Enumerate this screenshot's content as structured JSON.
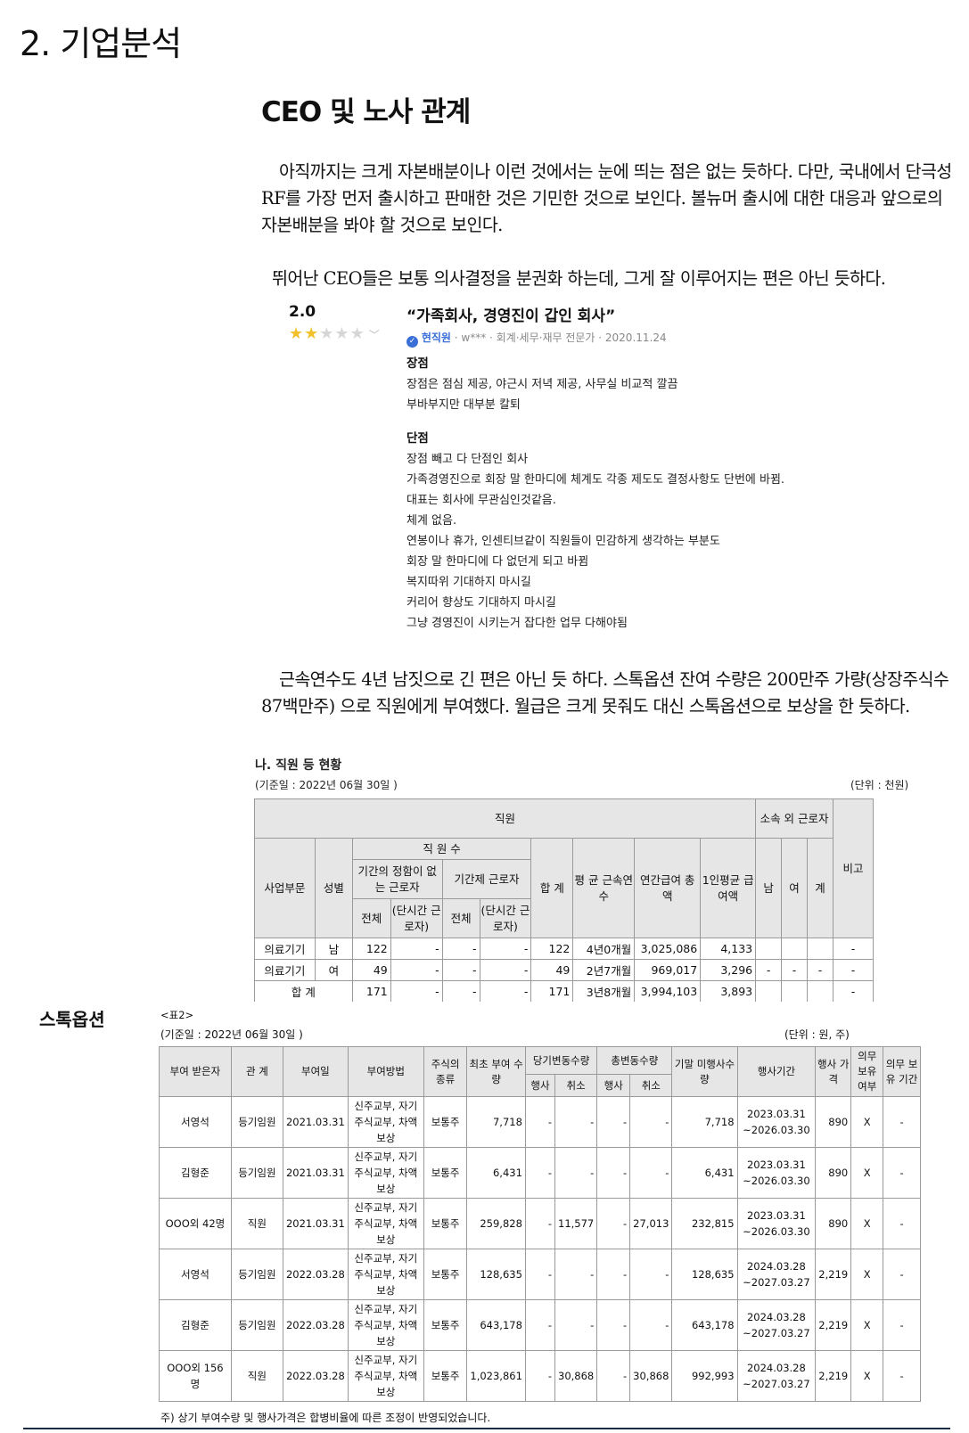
{
  "heading": "2. 기업분석",
  "subheading": "CEO 및 노사 관계",
  "paragraphs": {
    "p1": "아직까지는 크게 자본배분이나 이런 것에서는 눈에 띄는 점은 없는 듯하다. 다만, 국내에서 단극성 RF를 가장 먼저 출시하고 판매한 것은 기민한 것으로 보인다. 볼뉴머 출시에 대한 대응과 앞으로의 자본배분을 봐야 할 것으로 보인다.",
    "p2": "뛰어난 CEO들은 보통 의사결정을 분권화 하는데, 그게 잘 이루어지는 편은 아닌 듯하다.",
    "p3": "근속연수도 4년 남짓으로 긴 편은 아닌 듯 하다. 스톡옵션 잔여 수량은 200만주 가량(상장주식수 87백만주) 으로 직원에게 부여했다. 월급은 크게 못줘도 대신 스톡옵션으로 보상을 한 듯하다."
  },
  "review": {
    "score": "2.0",
    "stars_filled": 2,
    "stars_total": 5,
    "title": "“가족회사, 경영진이 갑인 회사”",
    "author": "현직원",
    "meta": " · w*** · 회계·세무·재무 전문가 · 2020.11.24",
    "pros_label": "장점",
    "pros": [
      "장점은 점심 제공, 야근시 저녁 제공, 사무실 비교적 깔끔",
      "부바부지만 대부분 칼퇴"
    ],
    "cons_label": "단점",
    "cons": [
      "장점 빼고 다 단점인 회사",
      "가족경영진으로 회장 말 한마디에 체계도 각종 제도도 결정사항도 단번에 바뀜.",
      "대표는 회사에 무관심인것같음.",
      "체계 없음.",
      "연봉이나 휴가, 인센티브같이 직원들이 민감하게 생각하는 부분도",
      "회장 말 한마디에 다 없던게 되고 바뀜",
      "복지따위 기대하지 마시길",
      "커리어 향상도 기대하지 마시길",
      "그냥 경영진이 시키는거 잡다한 업무 다해야됨"
    ]
  },
  "staff_table": {
    "title": "나. 직원 등 현황",
    "base_date": "(기준일 :      2022년 06월 30일    )",
    "unit": "(단위 : 천원)",
    "h_staff": "직원",
    "h_outside": "소속 외 근로자",
    "h_note": "비고",
    "h_dept": "사업부문",
    "h_gender": "성별",
    "h_count": "직 원 수",
    "h_regular": "기간의 정함이 없는 근로자",
    "h_contract": "기간제 근로자",
    "h_total": "합 계",
    "h_tenure": "평 균 근속연수",
    "h_pay_total": "연간급여 총 액",
    "h_pay_avg": "1인평균 급여액",
    "h_male": "남",
    "h_female": "여",
    "h_sum": "계",
    "h_all": "전체",
    "h_part": "(단시간 근로자)",
    "rows": [
      {
        "dept": "의료기기",
        "gender": "남",
        "reg_all": "122",
        "reg_part": "-",
        "con_all": "-",
        "con_part": "-",
        "total": "122",
        "tenure": "4년0개월",
        "pay_total": "3,025,086",
        "pay_avg": "4,133",
        "m": "",
        "f": "",
        "s": "",
        "note": "-"
      },
      {
        "dept": "의료기기",
        "gender": "여",
        "reg_all": "49",
        "reg_part": "-",
        "con_all": "-",
        "con_part": "-",
        "total": "49",
        "tenure": "2년7개월",
        "pay_total": "969,017",
        "pay_avg": "3,296",
        "m": "-",
        "f": "-",
        "s": "-",
        "note": "-"
      },
      {
        "dept": "합 계",
        "gender": "",
        "reg_all": "171",
        "reg_part": "-",
        "con_all": "-",
        "con_part": "-",
        "total": "171",
        "tenure": "3년8개월",
        "pay_total": "3,994,103",
        "pay_avg": "3,893",
        "m": "",
        "f": "",
        "s": "",
        "note": "-"
      }
    ]
  },
  "stock_option": {
    "title": "스톡옵션",
    "label": "<표2>",
    "base_date": "(기준일 :      2022년 06월 30일    )",
    "unit": "(단위 : 원, 주)",
    "headers": {
      "grantee": "부여 받은자",
      "relation": "관 계",
      "grant_date": "부여일",
      "method": "부여방법",
      "stock_type": "주식의 종류",
      "initial_qty": "최초 부여 수량",
      "period_change": "당기변동수량",
      "total_change": "총변동수량",
      "exercised": "행사",
      "cancelled": "취소",
      "ending_qty": "기말 미행사수량",
      "exercise_period": "행사기간",
      "exercise_price": "행사 가격",
      "holding_req": "의무 보유 여부",
      "holding_period": "의무 보유 기간"
    },
    "rows": [
      {
        "grantee": "서영석",
        "relation": "등기임원",
        "date": "2021.03.31",
        "method": "신주교부, 자기주식교부, 차액보상",
        "type": "보통주",
        "initial": "7,718",
        "p_ex": "-",
        "p_cx": "-",
        "t_ex": "-",
        "t_cx": "-",
        "ending": "7,718",
        "period": "2023.03.31 ~2026.03.30",
        "price": "890",
        "hold": "X",
        "hold_p": "-"
      },
      {
        "grantee": "김형준",
        "relation": "등기임원",
        "date": "2021.03.31",
        "method": "신주교부, 자기주식교부, 차액보상",
        "type": "보통주",
        "initial": "6,431",
        "p_ex": "-",
        "p_cx": "-",
        "t_ex": "-",
        "t_cx": "-",
        "ending": "6,431",
        "period": "2023.03.31 ~2026.03.30",
        "price": "890",
        "hold": "X",
        "hold_p": "-"
      },
      {
        "grantee": "OOO외 42명",
        "relation": "직원",
        "date": "2021.03.31",
        "method": "신주교부, 자기주식교부, 차액보상",
        "type": "보통주",
        "initial": "259,828",
        "p_ex": "-",
        "p_cx": "11,577",
        "t_ex": "-",
        "t_cx": "27,013",
        "ending": "232,815",
        "period": "2023.03.31 ~2026.03.30",
        "price": "890",
        "hold": "X",
        "hold_p": "-"
      },
      {
        "grantee": "서영석",
        "relation": "등기임원",
        "date": "2022.03.28",
        "method": "신주교부, 자기주식교부, 차액보상",
        "type": "보통주",
        "initial": "128,635",
        "p_ex": "-",
        "p_cx": "-",
        "t_ex": "-",
        "t_cx": "-",
        "ending": "128,635",
        "period": "2024.03.28 ~2027.03.27",
        "price": "2,219",
        "hold": "X",
        "hold_p": "-"
      },
      {
        "grantee": "김형준",
        "relation": "등기임원",
        "date": "2022.03.28",
        "method": "신주교부, 자기주식교부, 차액보상",
        "type": "보통주",
        "initial": "643,178",
        "p_ex": "-",
        "p_cx": "-",
        "t_ex": "-",
        "t_cx": "-",
        "ending": "643,178",
        "period": "2024.03.28 ~2027.03.27",
        "price": "2,219",
        "hold": "X",
        "hold_p": "-"
      },
      {
        "grantee": "OOO외 156명",
        "relation": "직원",
        "date": "2022.03.28",
        "method": "신주교부, 자기주식교부, 차액보상",
        "type": "보통주",
        "initial": "1,023,861",
        "p_ex": "-",
        "p_cx": "30,868",
        "t_ex": "-",
        "t_cx": "30,868",
        "ending": "992,993",
        "period": "2024.03.28 ~2027.03.27",
        "price": "2,219",
        "hold": "X",
        "hold_p": "-"
      }
    ],
    "note": "주) 상기 부여수량 및 행사가격은 합병비율에 따른 조정이 반영되었습니다."
  },
  "colors": {
    "star_on": "#f2c02d",
    "star_off": "#d6d6d6",
    "accent": "#3b6fd8",
    "header_bg": "#e6e6e6",
    "rule": "#1d2a44"
  }
}
